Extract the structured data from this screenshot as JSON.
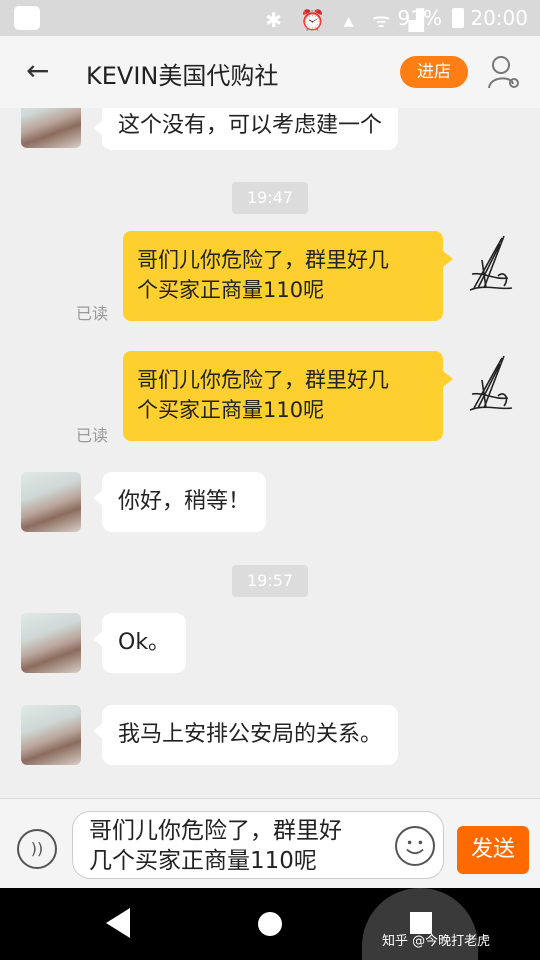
{
  "status_bar": {
    "icons": "✱ ⏰ ▴ ᯤ ▟",
    "battery": "91%",
    "time": "20:00"
  },
  "header": {
    "back_icon": "arrow-left-icon",
    "title": "KEVIN美国代购社",
    "shop_button": "进店",
    "user_icon": "user-settings-icon"
  },
  "messages": [
    {
      "side": "left",
      "text": "这个没有，可以考虑建一个"
    },
    {
      "type": "time",
      "text": "19:47"
    },
    {
      "side": "right",
      "line1": "哥们儿你危险了，群里好几",
      "line2": "个买家正商量110呢",
      "read": "已读"
    },
    {
      "side": "right",
      "line1": "哥们儿你危险了，群里好几",
      "line2": "个买家正商量110呢",
      "read": "已读"
    },
    {
      "side": "left",
      "text": "你好，稍等！"
    },
    {
      "type": "time",
      "text": "19:57"
    },
    {
      "side": "left",
      "text": "Ok。"
    },
    {
      "side": "left",
      "text": "我马上安排公安局的关系。"
    }
  ],
  "input_bar": {
    "voice_icon": "voice-icon",
    "line1": "哥们儿你危险了，群里好",
    "line2": "几个买家正商量110呢",
    "emoji_icon": "emoji-icon",
    "send": "发送"
  },
  "watermark": "知乎 @今晚打老虎",
  "colors": {
    "accent": "#ff7e14",
    "send": "#ff6a00",
    "bubble_self": "#fdd02f"
  }
}
